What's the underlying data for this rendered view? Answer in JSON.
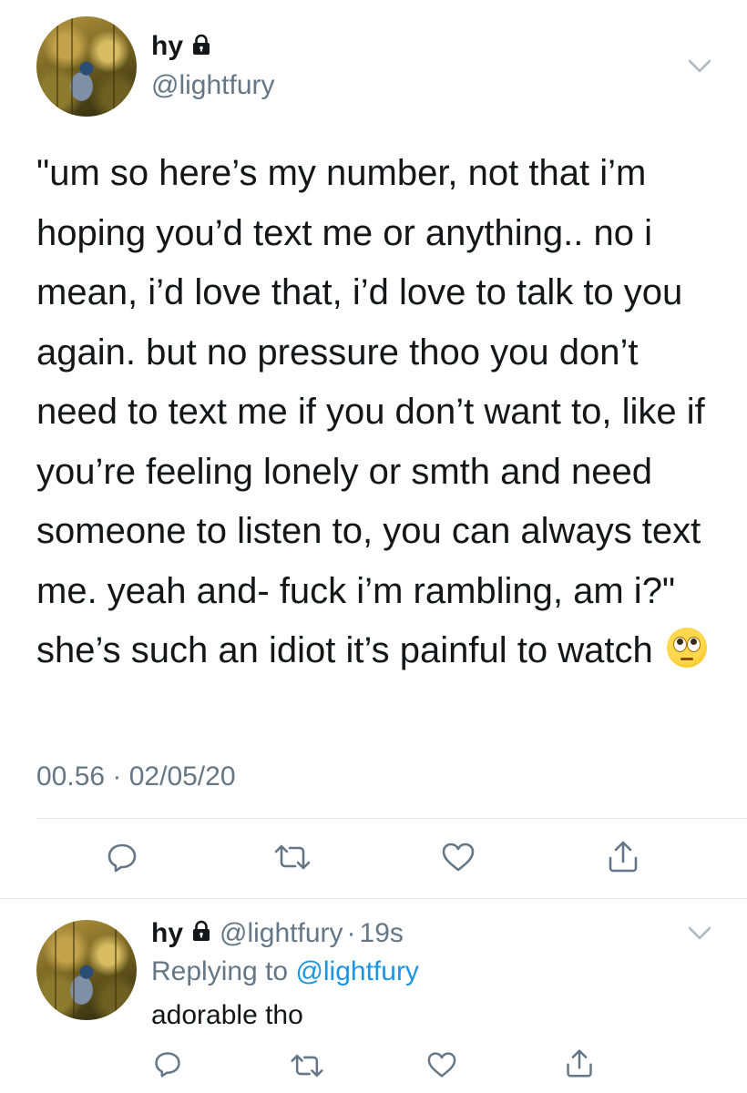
{
  "tweet": {
    "display_name": "hy",
    "handle": "@lightfury",
    "text": "\"um so here’s my number, not that i’m hoping you’d text me or anything.. no i mean, i’d love that, i’d love to talk to you again. but no pressure thoo you don’t need to text me if you don’t want to, like if you’re feeling lonely or smth and need someone to listen to, you can always text me. yeah and- fuck i’m rambling, am i?\" she’s such an idiot it’s painful to watch ",
    "emoji": "face-with-rolling-eyes",
    "timestamp": "00.56 · 02/05/20",
    "actions": [
      "reply-icon",
      "retweet-icon",
      "like-icon",
      "share-icon"
    ]
  },
  "reply": {
    "display_name": "hy",
    "handle": "@lightfury",
    "separator": "·",
    "age": "19s",
    "replying_to_prefix": "Replying to ",
    "replying_to_handle": "@lightfury",
    "text": "adorable tho"
  },
  "colors": {
    "text": "#14171a",
    "muted": "#657786",
    "link": "#1b95e0",
    "divider": "#e1e8ed"
  }
}
